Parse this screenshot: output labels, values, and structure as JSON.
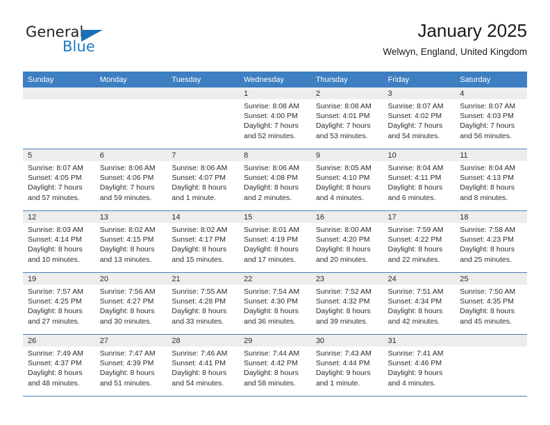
{
  "brand": {
    "name_part1": "General",
    "name_part2": "Blue",
    "triangle_color": "#1d6fb8",
    "blue_text_color": "#1e78c8"
  },
  "header": {
    "title": "January 2025",
    "subtitle": "Welwyn, England, United Kingdom"
  },
  "theme": {
    "header_bg": "#3d7fc1",
    "day_band_bg": "#ededed",
    "grid_line": "#4a7fb5",
    "cell_bg": "#ffffff",
    "text": "#2b2b2b"
  },
  "weekday_headers": [
    "Sunday",
    "Monday",
    "Tuesday",
    "Wednesday",
    "Thursday",
    "Friday",
    "Saturday"
  ],
  "labels": {
    "sunrise_prefix": "Sunrise:",
    "sunset_prefix": "Sunset:",
    "daylight_prefix": "Daylight:"
  },
  "weeks": [
    [
      {
        "day": "",
        "sunrise": "",
        "sunset": "",
        "daylight_line1": "",
        "daylight_line2": ""
      },
      {
        "day": "",
        "sunrise": "",
        "sunset": "",
        "daylight_line1": "",
        "daylight_line2": ""
      },
      {
        "day": "",
        "sunrise": "",
        "sunset": "",
        "daylight_line1": "",
        "daylight_line2": ""
      },
      {
        "day": "1",
        "sunrise": "Sunrise: 8:08 AM",
        "sunset": "Sunset: 4:00 PM",
        "daylight_line1": "Daylight: 7 hours",
        "daylight_line2": "and 52 minutes."
      },
      {
        "day": "2",
        "sunrise": "Sunrise: 8:08 AM",
        "sunset": "Sunset: 4:01 PM",
        "daylight_line1": "Daylight: 7 hours",
        "daylight_line2": "and 53 minutes."
      },
      {
        "day": "3",
        "sunrise": "Sunrise: 8:07 AM",
        "sunset": "Sunset: 4:02 PM",
        "daylight_line1": "Daylight: 7 hours",
        "daylight_line2": "and 54 minutes."
      },
      {
        "day": "4",
        "sunrise": "Sunrise: 8:07 AM",
        "sunset": "Sunset: 4:03 PM",
        "daylight_line1": "Daylight: 7 hours",
        "daylight_line2": "and 56 minutes."
      }
    ],
    [
      {
        "day": "5",
        "sunrise": "Sunrise: 8:07 AM",
        "sunset": "Sunset: 4:05 PM",
        "daylight_line1": "Daylight: 7 hours",
        "daylight_line2": "and 57 minutes."
      },
      {
        "day": "6",
        "sunrise": "Sunrise: 8:06 AM",
        "sunset": "Sunset: 4:06 PM",
        "daylight_line1": "Daylight: 7 hours",
        "daylight_line2": "and 59 minutes."
      },
      {
        "day": "7",
        "sunrise": "Sunrise: 8:06 AM",
        "sunset": "Sunset: 4:07 PM",
        "daylight_line1": "Daylight: 8 hours",
        "daylight_line2": "and 1 minute."
      },
      {
        "day": "8",
        "sunrise": "Sunrise: 8:06 AM",
        "sunset": "Sunset: 4:08 PM",
        "daylight_line1": "Daylight: 8 hours",
        "daylight_line2": "and 2 minutes."
      },
      {
        "day": "9",
        "sunrise": "Sunrise: 8:05 AM",
        "sunset": "Sunset: 4:10 PM",
        "daylight_line1": "Daylight: 8 hours",
        "daylight_line2": "and 4 minutes."
      },
      {
        "day": "10",
        "sunrise": "Sunrise: 8:04 AM",
        "sunset": "Sunset: 4:11 PM",
        "daylight_line1": "Daylight: 8 hours",
        "daylight_line2": "and 6 minutes."
      },
      {
        "day": "11",
        "sunrise": "Sunrise: 8:04 AM",
        "sunset": "Sunset: 4:13 PM",
        "daylight_line1": "Daylight: 8 hours",
        "daylight_line2": "and 8 minutes."
      }
    ],
    [
      {
        "day": "12",
        "sunrise": "Sunrise: 8:03 AM",
        "sunset": "Sunset: 4:14 PM",
        "daylight_line1": "Daylight: 8 hours",
        "daylight_line2": "and 10 minutes."
      },
      {
        "day": "13",
        "sunrise": "Sunrise: 8:02 AM",
        "sunset": "Sunset: 4:15 PM",
        "daylight_line1": "Daylight: 8 hours",
        "daylight_line2": "and 13 minutes."
      },
      {
        "day": "14",
        "sunrise": "Sunrise: 8:02 AM",
        "sunset": "Sunset: 4:17 PM",
        "daylight_line1": "Daylight: 8 hours",
        "daylight_line2": "and 15 minutes."
      },
      {
        "day": "15",
        "sunrise": "Sunrise: 8:01 AM",
        "sunset": "Sunset: 4:19 PM",
        "daylight_line1": "Daylight: 8 hours",
        "daylight_line2": "and 17 minutes."
      },
      {
        "day": "16",
        "sunrise": "Sunrise: 8:00 AM",
        "sunset": "Sunset: 4:20 PM",
        "daylight_line1": "Daylight: 8 hours",
        "daylight_line2": "and 20 minutes."
      },
      {
        "day": "17",
        "sunrise": "Sunrise: 7:59 AM",
        "sunset": "Sunset: 4:22 PM",
        "daylight_line1": "Daylight: 8 hours",
        "daylight_line2": "and 22 minutes."
      },
      {
        "day": "18",
        "sunrise": "Sunrise: 7:58 AM",
        "sunset": "Sunset: 4:23 PM",
        "daylight_line1": "Daylight: 8 hours",
        "daylight_line2": "and 25 minutes."
      }
    ],
    [
      {
        "day": "19",
        "sunrise": "Sunrise: 7:57 AM",
        "sunset": "Sunset: 4:25 PM",
        "daylight_line1": "Daylight: 8 hours",
        "daylight_line2": "and 27 minutes."
      },
      {
        "day": "20",
        "sunrise": "Sunrise: 7:56 AM",
        "sunset": "Sunset: 4:27 PM",
        "daylight_line1": "Daylight: 8 hours",
        "daylight_line2": "and 30 minutes."
      },
      {
        "day": "21",
        "sunrise": "Sunrise: 7:55 AM",
        "sunset": "Sunset: 4:28 PM",
        "daylight_line1": "Daylight: 8 hours",
        "daylight_line2": "and 33 minutes."
      },
      {
        "day": "22",
        "sunrise": "Sunrise: 7:54 AM",
        "sunset": "Sunset: 4:30 PM",
        "daylight_line1": "Daylight: 8 hours",
        "daylight_line2": "and 36 minutes."
      },
      {
        "day": "23",
        "sunrise": "Sunrise: 7:52 AM",
        "sunset": "Sunset: 4:32 PM",
        "daylight_line1": "Daylight: 8 hours",
        "daylight_line2": "and 39 minutes."
      },
      {
        "day": "24",
        "sunrise": "Sunrise: 7:51 AM",
        "sunset": "Sunset: 4:34 PM",
        "daylight_line1": "Daylight: 8 hours",
        "daylight_line2": "and 42 minutes."
      },
      {
        "day": "25",
        "sunrise": "Sunrise: 7:50 AM",
        "sunset": "Sunset: 4:35 PM",
        "daylight_line1": "Daylight: 8 hours",
        "daylight_line2": "and 45 minutes."
      }
    ],
    [
      {
        "day": "26",
        "sunrise": "Sunrise: 7:49 AM",
        "sunset": "Sunset: 4:37 PM",
        "daylight_line1": "Daylight: 8 hours",
        "daylight_line2": "and 48 minutes."
      },
      {
        "day": "27",
        "sunrise": "Sunrise: 7:47 AM",
        "sunset": "Sunset: 4:39 PM",
        "daylight_line1": "Daylight: 8 hours",
        "daylight_line2": "and 51 minutes."
      },
      {
        "day": "28",
        "sunrise": "Sunrise: 7:46 AM",
        "sunset": "Sunset: 4:41 PM",
        "daylight_line1": "Daylight: 8 hours",
        "daylight_line2": "and 54 minutes."
      },
      {
        "day": "29",
        "sunrise": "Sunrise: 7:44 AM",
        "sunset": "Sunset: 4:42 PM",
        "daylight_line1": "Daylight: 8 hours",
        "daylight_line2": "and 58 minutes."
      },
      {
        "day": "30",
        "sunrise": "Sunrise: 7:43 AM",
        "sunset": "Sunset: 4:44 PM",
        "daylight_line1": "Daylight: 9 hours",
        "daylight_line2": "and 1 minute."
      },
      {
        "day": "31",
        "sunrise": "Sunrise: 7:41 AM",
        "sunset": "Sunset: 4:46 PM",
        "daylight_line1": "Daylight: 9 hours",
        "daylight_line2": "and 4 minutes."
      },
      {
        "day": "",
        "sunrise": "",
        "sunset": "",
        "daylight_line1": "",
        "daylight_line2": ""
      }
    ]
  ]
}
